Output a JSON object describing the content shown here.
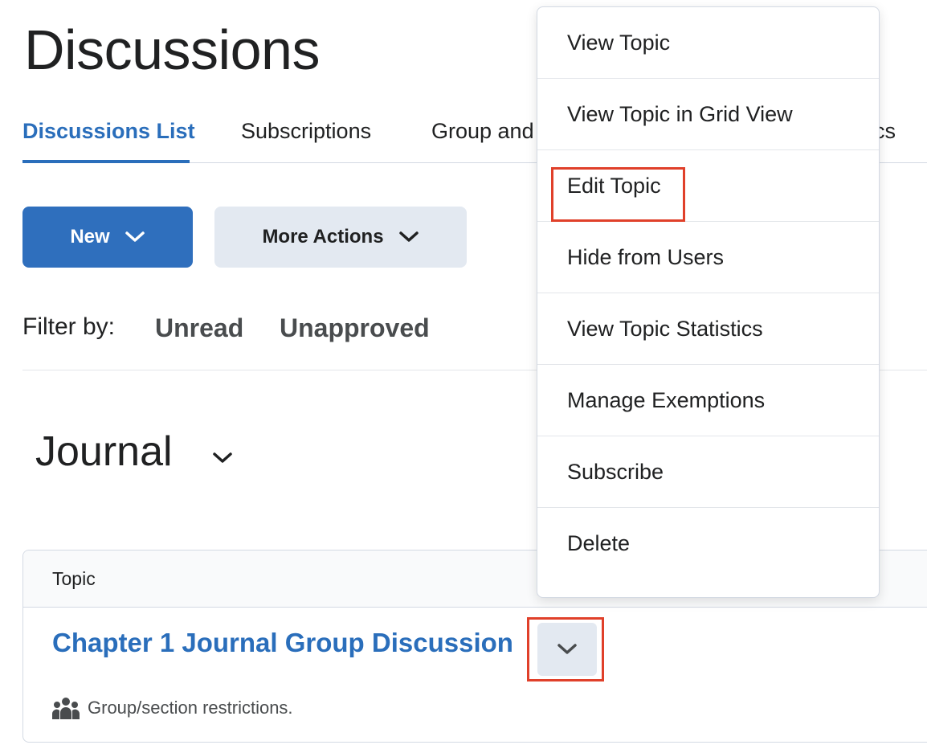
{
  "page": {
    "title": "Discussions"
  },
  "tabs": [
    {
      "label": "Discussions List",
      "active": true
    },
    {
      "label": "Subscriptions",
      "active": false
    },
    {
      "label": "Group and",
      "active": false
    },
    {
      "label": "cs",
      "active": false
    }
  ],
  "toolbar": {
    "new_label": "New",
    "more_actions_label": "More Actions"
  },
  "filter": {
    "label": "Filter by:",
    "options": [
      "Unread",
      "Unapproved"
    ]
  },
  "section": {
    "title": "Journal"
  },
  "table": {
    "header": "Topic",
    "rows": [
      {
        "title": "Chapter 1 Journal Group Discussion",
        "restriction": "Group/section restrictions."
      }
    ]
  },
  "context_menu": {
    "items": [
      "View Topic",
      "View Topic in Grid View",
      "Edit Topic",
      "Hide from Users",
      "View Topic Statistics",
      "Manage Exemptions",
      "Subscribe",
      "Delete"
    ],
    "highlighted_item": "Edit Topic"
  },
  "colors": {
    "accent": "#2a6ebb",
    "primary_button": "#2f6fbd",
    "secondary_button": "#e3e9f1",
    "highlight": "#e0402a"
  },
  "icons": {
    "dropdown": "chevron-down-icon",
    "restriction": "group-icon"
  }
}
